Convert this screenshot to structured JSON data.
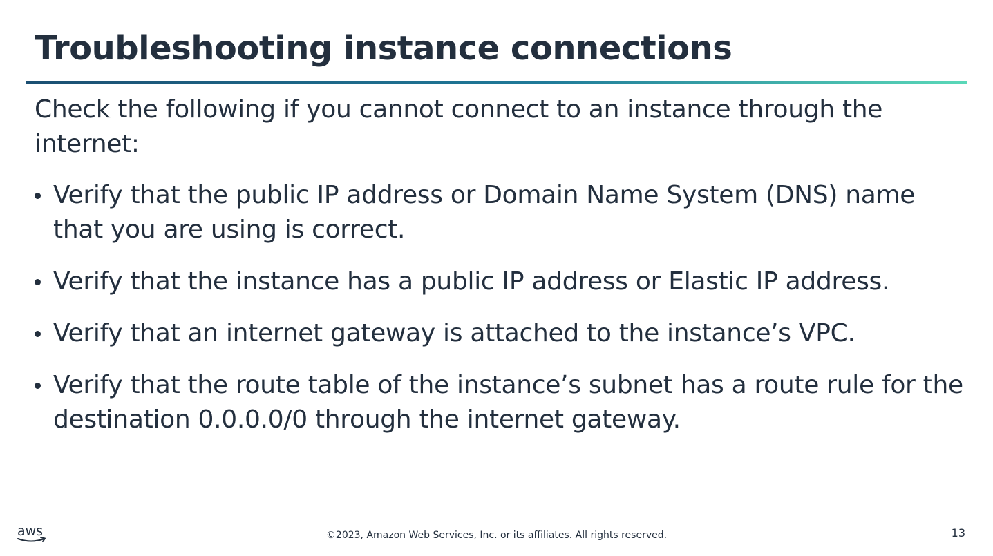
{
  "slide": {
    "title": "Troubleshooting instance connections",
    "intro": "Check the following if you cannot connect to an instance through the internet:",
    "bullets": [
      "Verify that the public IP address or Domain Name System (DNS) name that you are using is correct.",
      "Verify that the instance has a public IP address or Elastic IP address.",
      "Verify that an internet gateway is attached to the instance’s VPC.",
      "Verify that the route table of the instance’s subnet has a route rule for the destination 0.0.0.0/0 through the internet gateway."
    ]
  },
  "footer": {
    "logo_text": "aws",
    "copyright": "©2023, Amazon Web Services, Inc. or its affiliates. All rights reserved.",
    "page_number": "13"
  },
  "colors": {
    "text": "#232f3e",
    "rule_start": "#1b4f72",
    "rule_end": "#5ad8b8",
    "logo_smile": "#232f3e"
  },
  "icons": {
    "logo": "aws-logo-icon"
  }
}
